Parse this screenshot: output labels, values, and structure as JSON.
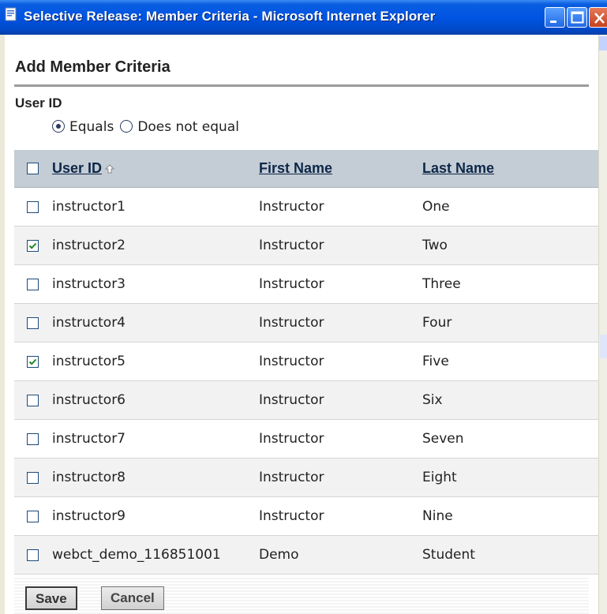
{
  "window": {
    "title": "Selective Release: Member Criteria - Microsoft Internet Explorer"
  },
  "page": {
    "heading": "Add Member Criteria"
  },
  "filter": {
    "field_label": "User ID",
    "options": [
      {
        "label": "Equals",
        "selected": true
      },
      {
        "label": "Does not equal",
        "selected": false
      }
    ]
  },
  "table": {
    "columns": [
      {
        "label": "User ID",
        "sorted": "ascending"
      },
      {
        "label": "First Name"
      },
      {
        "label": "Last Name"
      }
    ],
    "rows": [
      {
        "checked": false,
        "user_id": "instructor1",
        "first_name": "Instructor",
        "last_name": "One"
      },
      {
        "checked": true,
        "user_id": "instructor2",
        "first_name": "Instructor",
        "last_name": "Two"
      },
      {
        "checked": false,
        "user_id": "instructor3",
        "first_name": "Instructor",
        "last_name": "Three"
      },
      {
        "checked": false,
        "user_id": "instructor4",
        "first_name": "Instructor",
        "last_name": "Four"
      },
      {
        "checked": true,
        "user_id": "instructor5",
        "first_name": "Instructor",
        "last_name": "Five"
      },
      {
        "checked": false,
        "user_id": "instructor6",
        "first_name": "Instructor",
        "last_name": "Six"
      },
      {
        "checked": false,
        "user_id": "instructor7",
        "first_name": "Instructor",
        "last_name": "Seven"
      },
      {
        "checked": false,
        "user_id": "instructor8",
        "first_name": "Instructor",
        "last_name": "Eight"
      },
      {
        "checked": false,
        "user_id": "instructor9",
        "first_name": "Instructor",
        "last_name": "Nine"
      },
      {
        "checked": false,
        "user_id": "webct_demo_116851001",
        "first_name": "Demo",
        "last_name": "Student"
      }
    ]
  },
  "footer": {
    "save_label": "Save",
    "cancel_label": "Cancel"
  },
  "icons": {
    "title_icon": "ie-page-icon",
    "sort_icon": "sort-ascending-arrow-icon",
    "check_icon": "checkmark-icon"
  },
  "colors": {
    "titlebar": "#0054e3",
    "header_row": "#c4ccd5",
    "checkbox_border": "#1c4a7a",
    "checkmark": "#1f8a1f"
  }
}
